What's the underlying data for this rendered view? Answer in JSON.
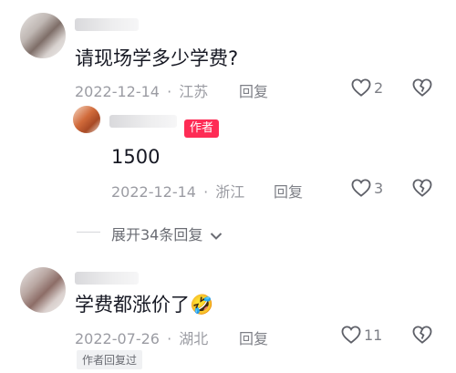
{
  "comments": [
    {
      "text": "请现场学多少学费?",
      "date": "2022-12-14",
      "location": "江苏",
      "reply_label": "回复",
      "likes": "2"
    },
    {
      "author_badge": "作者",
      "text": "1500",
      "date": "2022-12-14",
      "location": "浙江",
      "reply_label": "回复",
      "likes": "3"
    },
    {
      "text": "学费都涨价了",
      "emoji": "🤣",
      "date": "2022-07-26",
      "location": "湖北",
      "reply_label": "回复",
      "likes": "11",
      "author_replied": "作者回复过"
    }
  ],
  "expand_replies": "展开34条回复",
  "separator": "·",
  "icons": {
    "like": "heart-outline-icon",
    "dislike": "broken-heart-icon",
    "expand": "chevron-down-icon"
  },
  "colors": {
    "badge": "#fe2c55",
    "meta": "#9b9ca3",
    "text": "#161823"
  }
}
